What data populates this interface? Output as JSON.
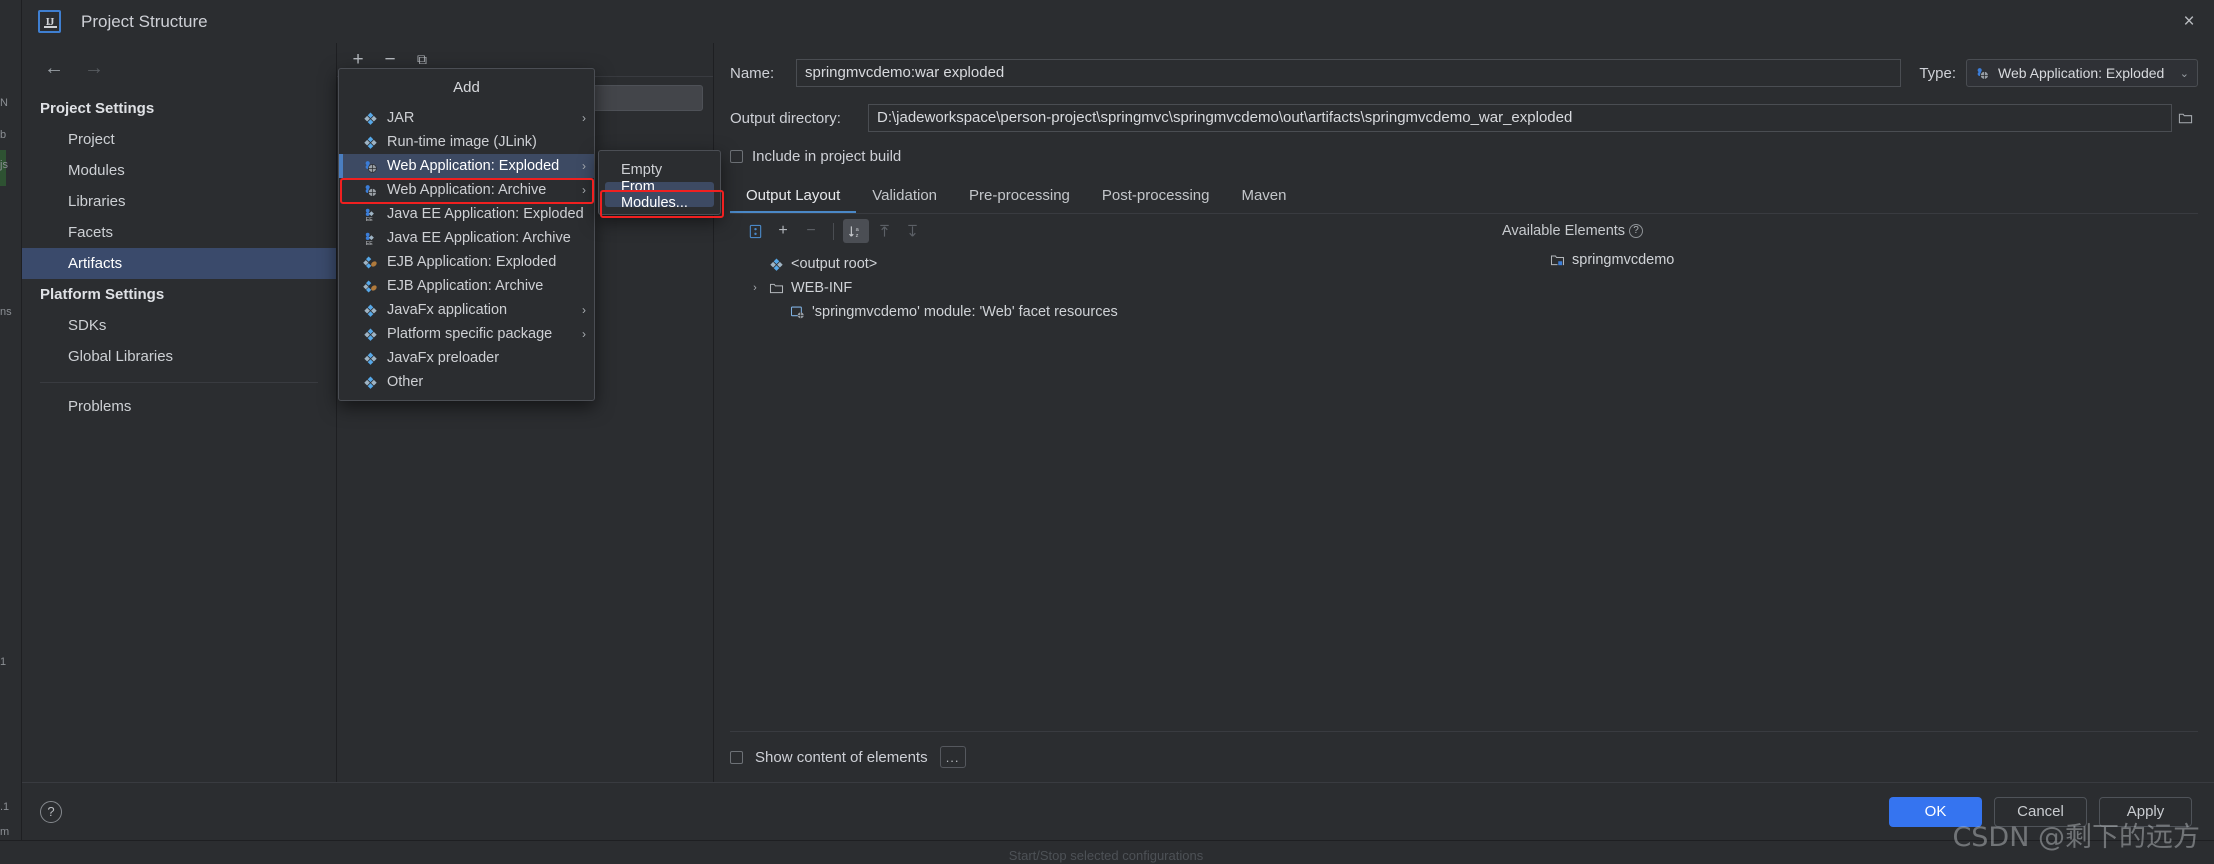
{
  "window": {
    "title": "Project Structure",
    "logo_alt": "IJ",
    "close_label": "×"
  },
  "sidebar": {
    "back_label": "←",
    "forward_label": "→",
    "groups": [
      {
        "title": "Project Settings",
        "items": [
          {
            "label": "Project",
            "selected": false
          },
          {
            "label": "Modules",
            "selected": false
          },
          {
            "label": "Libraries",
            "selected": false
          },
          {
            "label": "Facets",
            "selected": false
          },
          {
            "label": "Artifacts",
            "selected": true
          }
        ]
      },
      {
        "title": "Platform Settings",
        "items": [
          {
            "label": "SDKs",
            "selected": false
          },
          {
            "label": "Global Libraries",
            "selected": false
          }
        ]
      }
    ],
    "problems_label": "Problems"
  },
  "artifacts_toolbar": {
    "add_label": "+",
    "remove_label": "−",
    "copy_label": "⧉",
    "search_value": "",
    "search_placeholder": ""
  },
  "add_menu": {
    "header": "Add",
    "items": [
      {
        "label": "JAR",
        "icon": "artifact-icon",
        "has_submenu": true,
        "selected": false
      },
      {
        "label": "Run-time image (JLink)",
        "icon": "artifact-icon",
        "has_submenu": false,
        "selected": false
      },
      {
        "label": "Web Application: Exploded",
        "icon": "web-artifact-icon",
        "has_submenu": true,
        "selected": true
      },
      {
        "label": "Web Application: Archive",
        "icon": "web-artifact-icon",
        "has_submenu": true,
        "selected": false
      },
      {
        "label": "Java EE Application: Exploded",
        "icon": "javaee-artifact-icon",
        "has_submenu": false,
        "selected": false
      },
      {
        "label": "Java EE Application: Archive",
        "icon": "javaee-artifact-icon",
        "has_submenu": false,
        "selected": false
      },
      {
        "label": "EJB Application: Exploded",
        "icon": "ejb-artifact-icon",
        "has_submenu": false,
        "selected": false
      },
      {
        "label": "EJB Application: Archive",
        "icon": "ejb-artifact-icon",
        "has_submenu": false,
        "selected": false
      },
      {
        "label": "JavaFx application",
        "icon": "artifact-icon",
        "has_submenu": true,
        "selected": false
      },
      {
        "label": "Platform specific package",
        "icon": "artifact-icon",
        "has_submenu": true,
        "selected": false
      },
      {
        "label": "JavaFx preloader",
        "icon": "artifact-icon",
        "has_submenu": false,
        "selected": false
      },
      {
        "label": "Other",
        "icon": "artifact-icon",
        "has_submenu": false,
        "selected": false
      }
    ]
  },
  "add_submenu": {
    "items": [
      {
        "label": "Empty",
        "selected": false
      },
      {
        "label": "From Modules...",
        "selected": true
      }
    ]
  },
  "detail": {
    "name_label": "Name:",
    "name_value": "springmvcdemo:war exploded",
    "type_label": "Type:",
    "type_value": "Web Application: Exploded",
    "type_icon": "web-artifact-icon",
    "type_caret": "⌄",
    "output_dir_label": "Output directory:",
    "output_dir_value": "D:\\jadeworkspace\\person-project\\springmvc\\springmvcdemo\\out\\artifacts\\springmvcdemo_war_exploded",
    "browse_icon": "folder-icon",
    "include_in_build_label": "Include in project build",
    "include_in_build_checked": false,
    "tabs": [
      {
        "label": "Output Layout",
        "active": true
      },
      {
        "label": "Validation",
        "active": false
      },
      {
        "label": "Pre-processing",
        "active": false
      },
      {
        "label": "Post-processing",
        "active": false
      },
      {
        "label": "Maven",
        "active": false
      }
    ],
    "layout_toolbar": [
      {
        "name": "show-included-icon",
        "glyph": "Ⓑ",
        "state": "on-blue"
      },
      {
        "name": "add-icon",
        "glyph": "+",
        "state": "normal"
      },
      {
        "name": "remove-icon",
        "glyph": "−",
        "state": "disabled"
      },
      {
        "name": "sort-icon",
        "glyph": "↓",
        "state": "on"
      },
      {
        "name": "move-up-icon",
        "glyph": "↑",
        "state": "disabled"
      },
      {
        "name": "move-down-icon",
        "glyph": "↓",
        "state": "disabled"
      }
    ],
    "output_tree": [
      {
        "label": "<output root>",
        "icon": "artifact-icon",
        "indent": 0,
        "twisty": "none"
      },
      {
        "label": "WEB-INF",
        "icon": "folder-icon",
        "indent": 0,
        "twisty": "collapsed"
      },
      {
        "label": "'springmvcdemo' module: 'Web' facet resources",
        "icon": "module-web-icon",
        "indent": 1,
        "twisty": "none"
      }
    ],
    "available_elements_label": "Available Elements",
    "available_help": "?",
    "available_tree": [
      {
        "label": "springmvcdemo",
        "icon": "module-folder-icon"
      }
    ],
    "show_content_label": "Show content of elements",
    "show_content_checked": false,
    "dots_label": "..."
  },
  "footer": {
    "help_label": "?",
    "ok_label": "OK",
    "cancel_label": "Cancel",
    "apply_label": "Apply"
  },
  "ide_background": {
    "left_gutter_fragments": [
      "N",
      "b",
      "js",
      "ns",
      "1",
      ".1",
      "m"
    ],
    "status_text": "Start/Stop selected configurations",
    "watermark": "CSDN @剩下的远方"
  }
}
